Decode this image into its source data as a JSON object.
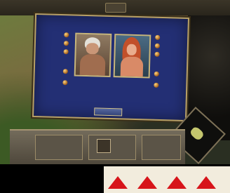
{
  "screen": {
    "background_color": "#1a1612",
    "dialog_color": "#232f74",
    "frame_color": "#b8a064",
    "accent_red": "#d7141a"
  },
  "dialog": {
    "title": "",
    "left_labels": [
      "",
      "",
      "",
      "",
      ""
    ],
    "right_labels": [
      "",
      "",
      "",
      "",
      ""
    ],
    "stats_text": "",
    "ok_label": ""
  },
  "icons": {
    "stat_icon": "orb-icon",
    "minimap": "minimap-icon",
    "arrow": "arrow-up-icon"
  },
  "magazine": {
    "arrow_count": 4
  }
}
